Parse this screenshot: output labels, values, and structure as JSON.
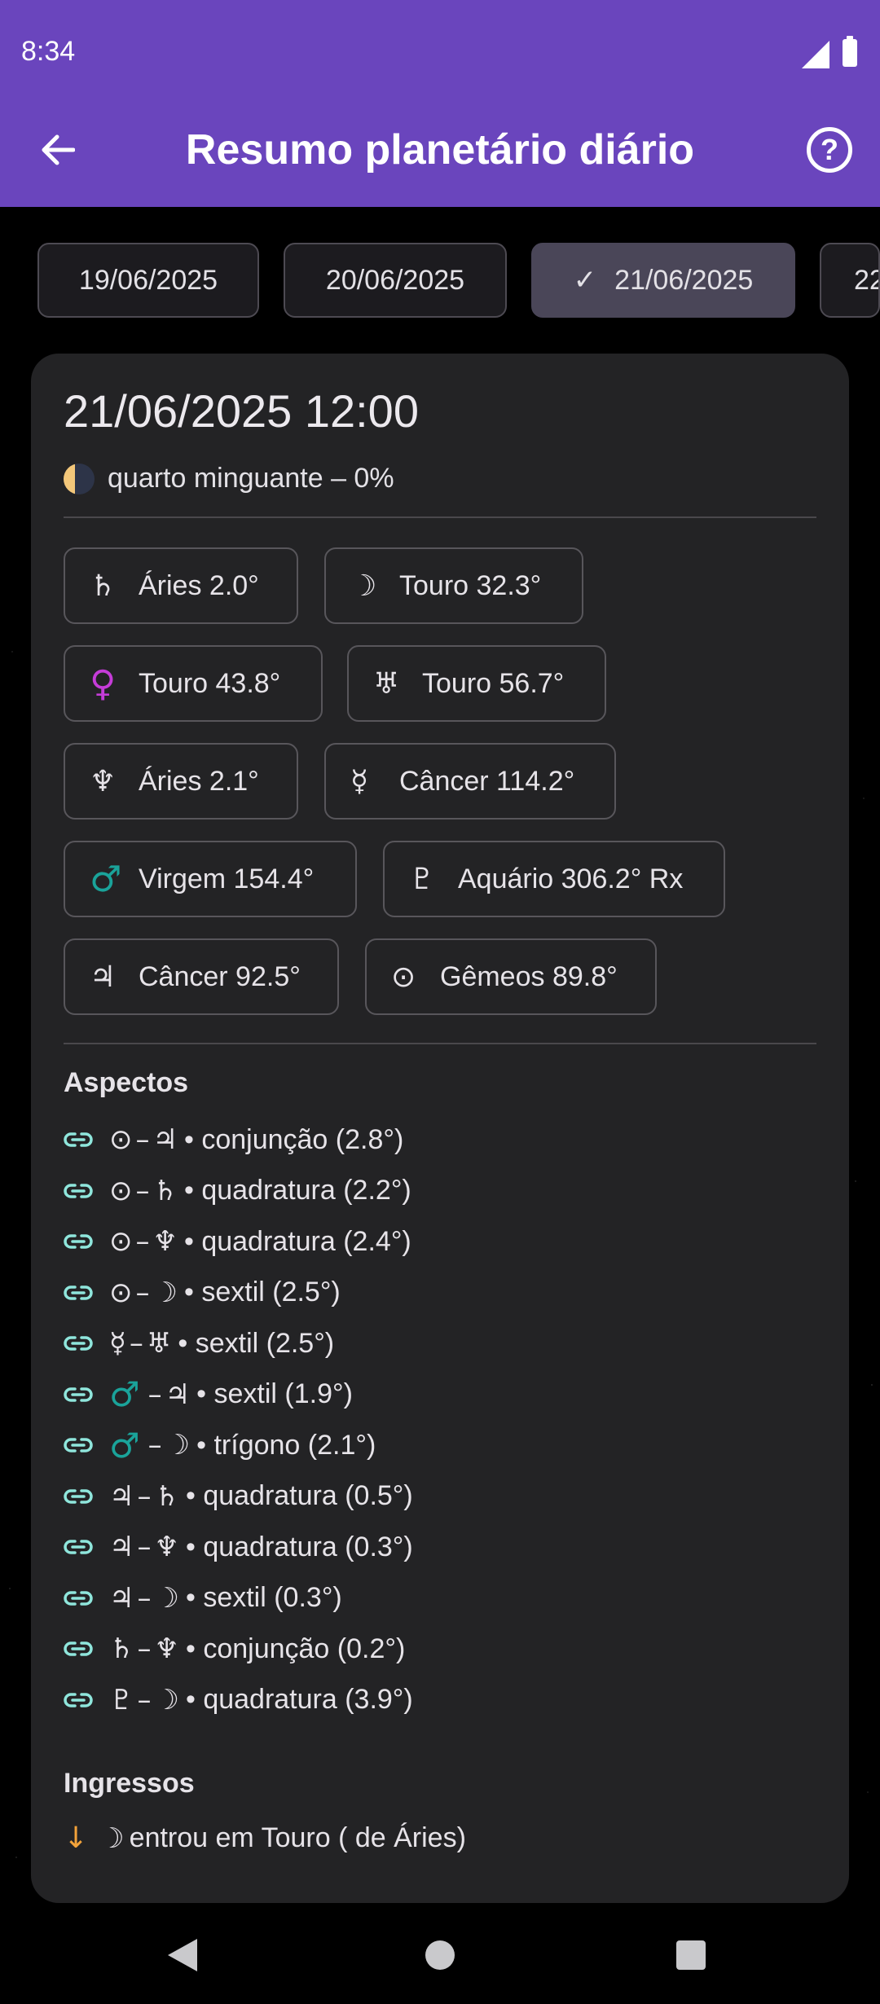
{
  "status_bar": {
    "time": "8:34"
  },
  "app_bar": {
    "title": "Resumo planetário diário"
  },
  "date_tabs": [
    {
      "label": "19/06/2025",
      "selected": false
    },
    {
      "label": "20/06/2025",
      "selected": false
    },
    {
      "label": "21/06/2025",
      "selected": true
    },
    {
      "label": "22",
      "selected": false
    }
  ],
  "summary": {
    "datetime": "21/06/2025 12:00",
    "moon_phase": "quarto minguante – 0%"
  },
  "planets": [
    {
      "symbol": "♄",
      "text": "Áries 2.0°"
    },
    {
      "symbol": "☽",
      "text": "Touro 32.3°"
    },
    {
      "symbol": "♀",
      "text": "Touro 43.8°"
    },
    {
      "symbol": "♅",
      "text": "Touro 56.7°"
    },
    {
      "symbol": "♆",
      "text": "Áries 2.1°"
    },
    {
      "symbol": "☿",
      "text": "Câncer 114.2°"
    },
    {
      "symbol": "♂",
      "text": "Virgem 154.4°"
    },
    {
      "symbol": "♇",
      "text": "Aquário 306.2° Rx"
    },
    {
      "symbol": "♃",
      "text": "Câncer 92.5°"
    },
    {
      "symbol": "⊙",
      "text": "Gêmeos 89.8°"
    }
  ],
  "aspects_title": "Aspectos",
  "aspects": [
    {
      "a": "⊙",
      "b": "♃",
      "text": "• conjunção (2.8°)"
    },
    {
      "a": "⊙",
      "b": "♄",
      "text": "• quadratura (2.2°)"
    },
    {
      "a": "⊙",
      "b": "♆",
      "text": "• quadratura (2.4°)"
    },
    {
      "a": "⊙",
      "b": "☽",
      "text": "• sextil (2.5°)"
    },
    {
      "a": "☿",
      "b": "♅",
      "text": "• sextil (2.5°)"
    },
    {
      "a": "♂",
      "b": "♃",
      "text": "• sextil (1.9°)"
    },
    {
      "a": "♂",
      "b": "☽",
      "text": "• trígono (2.1°)"
    },
    {
      "a": "♃",
      "b": "♄",
      "text": "• quadratura (0.5°)"
    },
    {
      "a": "♃",
      "b": "♆",
      "text": "• quadratura (0.3°)"
    },
    {
      "a": "♃",
      "b": "☽",
      "text": "• sextil (0.3°)"
    },
    {
      "a": "♄",
      "b": "♆",
      "text": "• conjunção (0.2°)"
    },
    {
      "a": "♇",
      "b": "☽",
      "text": "• quadratura (3.9°)"
    }
  ],
  "ingress_title": "Ingressos",
  "ingress": {
    "symbol": "☽",
    "text": "entrou em Touro ( de Áries)"
  },
  "colors": {
    "app_bar": "#6a45bd",
    "venus": "#c53cd8",
    "mars": "#1aa39a",
    "link_icon": "#8fe6dc",
    "ingress_arrow": "#f2a23a"
  }
}
